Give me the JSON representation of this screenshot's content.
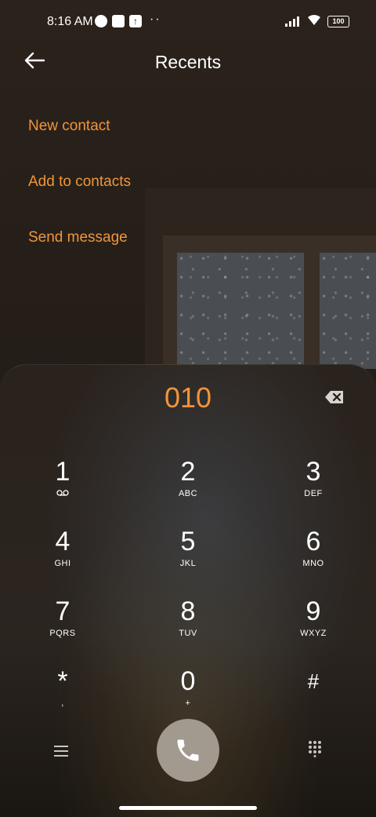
{
  "status_bar": {
    "time": "8:16 AM",
    "battery": "100"
  },
  "header": {
    "title": "Recents"
  },
  "menu": [
    "New contact",
    "Add to contacts",
    "Send message"
  ],
  "dialpad": {
    "entered_number": "010",
    "keys": [
      {
        "digit": "1",
        "letters": ""
      },
      {
        "digit": "2",
        "letters": "ABC"
      },
      {
        "digit": "3",
        "letters": "DEF"
      },
      {
        "digit": "4",
        "letters": "GHI"
      },
      {
        "digit": "5",
        "letters": "JKL"
      },
      {
        "digit": "6",
        "letters": "MNO"
      },
      {
        "digit": "7",
        "letters": "PQRS"
      },
      {
        "digit": "8",
        "letters": "TUV"
      },
      {
        "digit": "9",
        "letters": "WXYZ"
      },
      {
        "digit": "*",
        "letters": ","
      },
      {
        "digit": "0",
        "letters": "+"
      },
      {
        "digit": "#",
        "letters": ""
      }
    ]
  },
  "icons": {
    "back": "arrow-left-icon",
    "backspace": "backspace-icon",
    "voicemail": "voicemail-icon",
    "menu": "menu-icon",
    "call": "phone-icon",
    "keypad": "keypad-icon"
  },
  "colors": {
    "accent": "#f0953b",
    "call_button": "#a29a8f"
  }
}
